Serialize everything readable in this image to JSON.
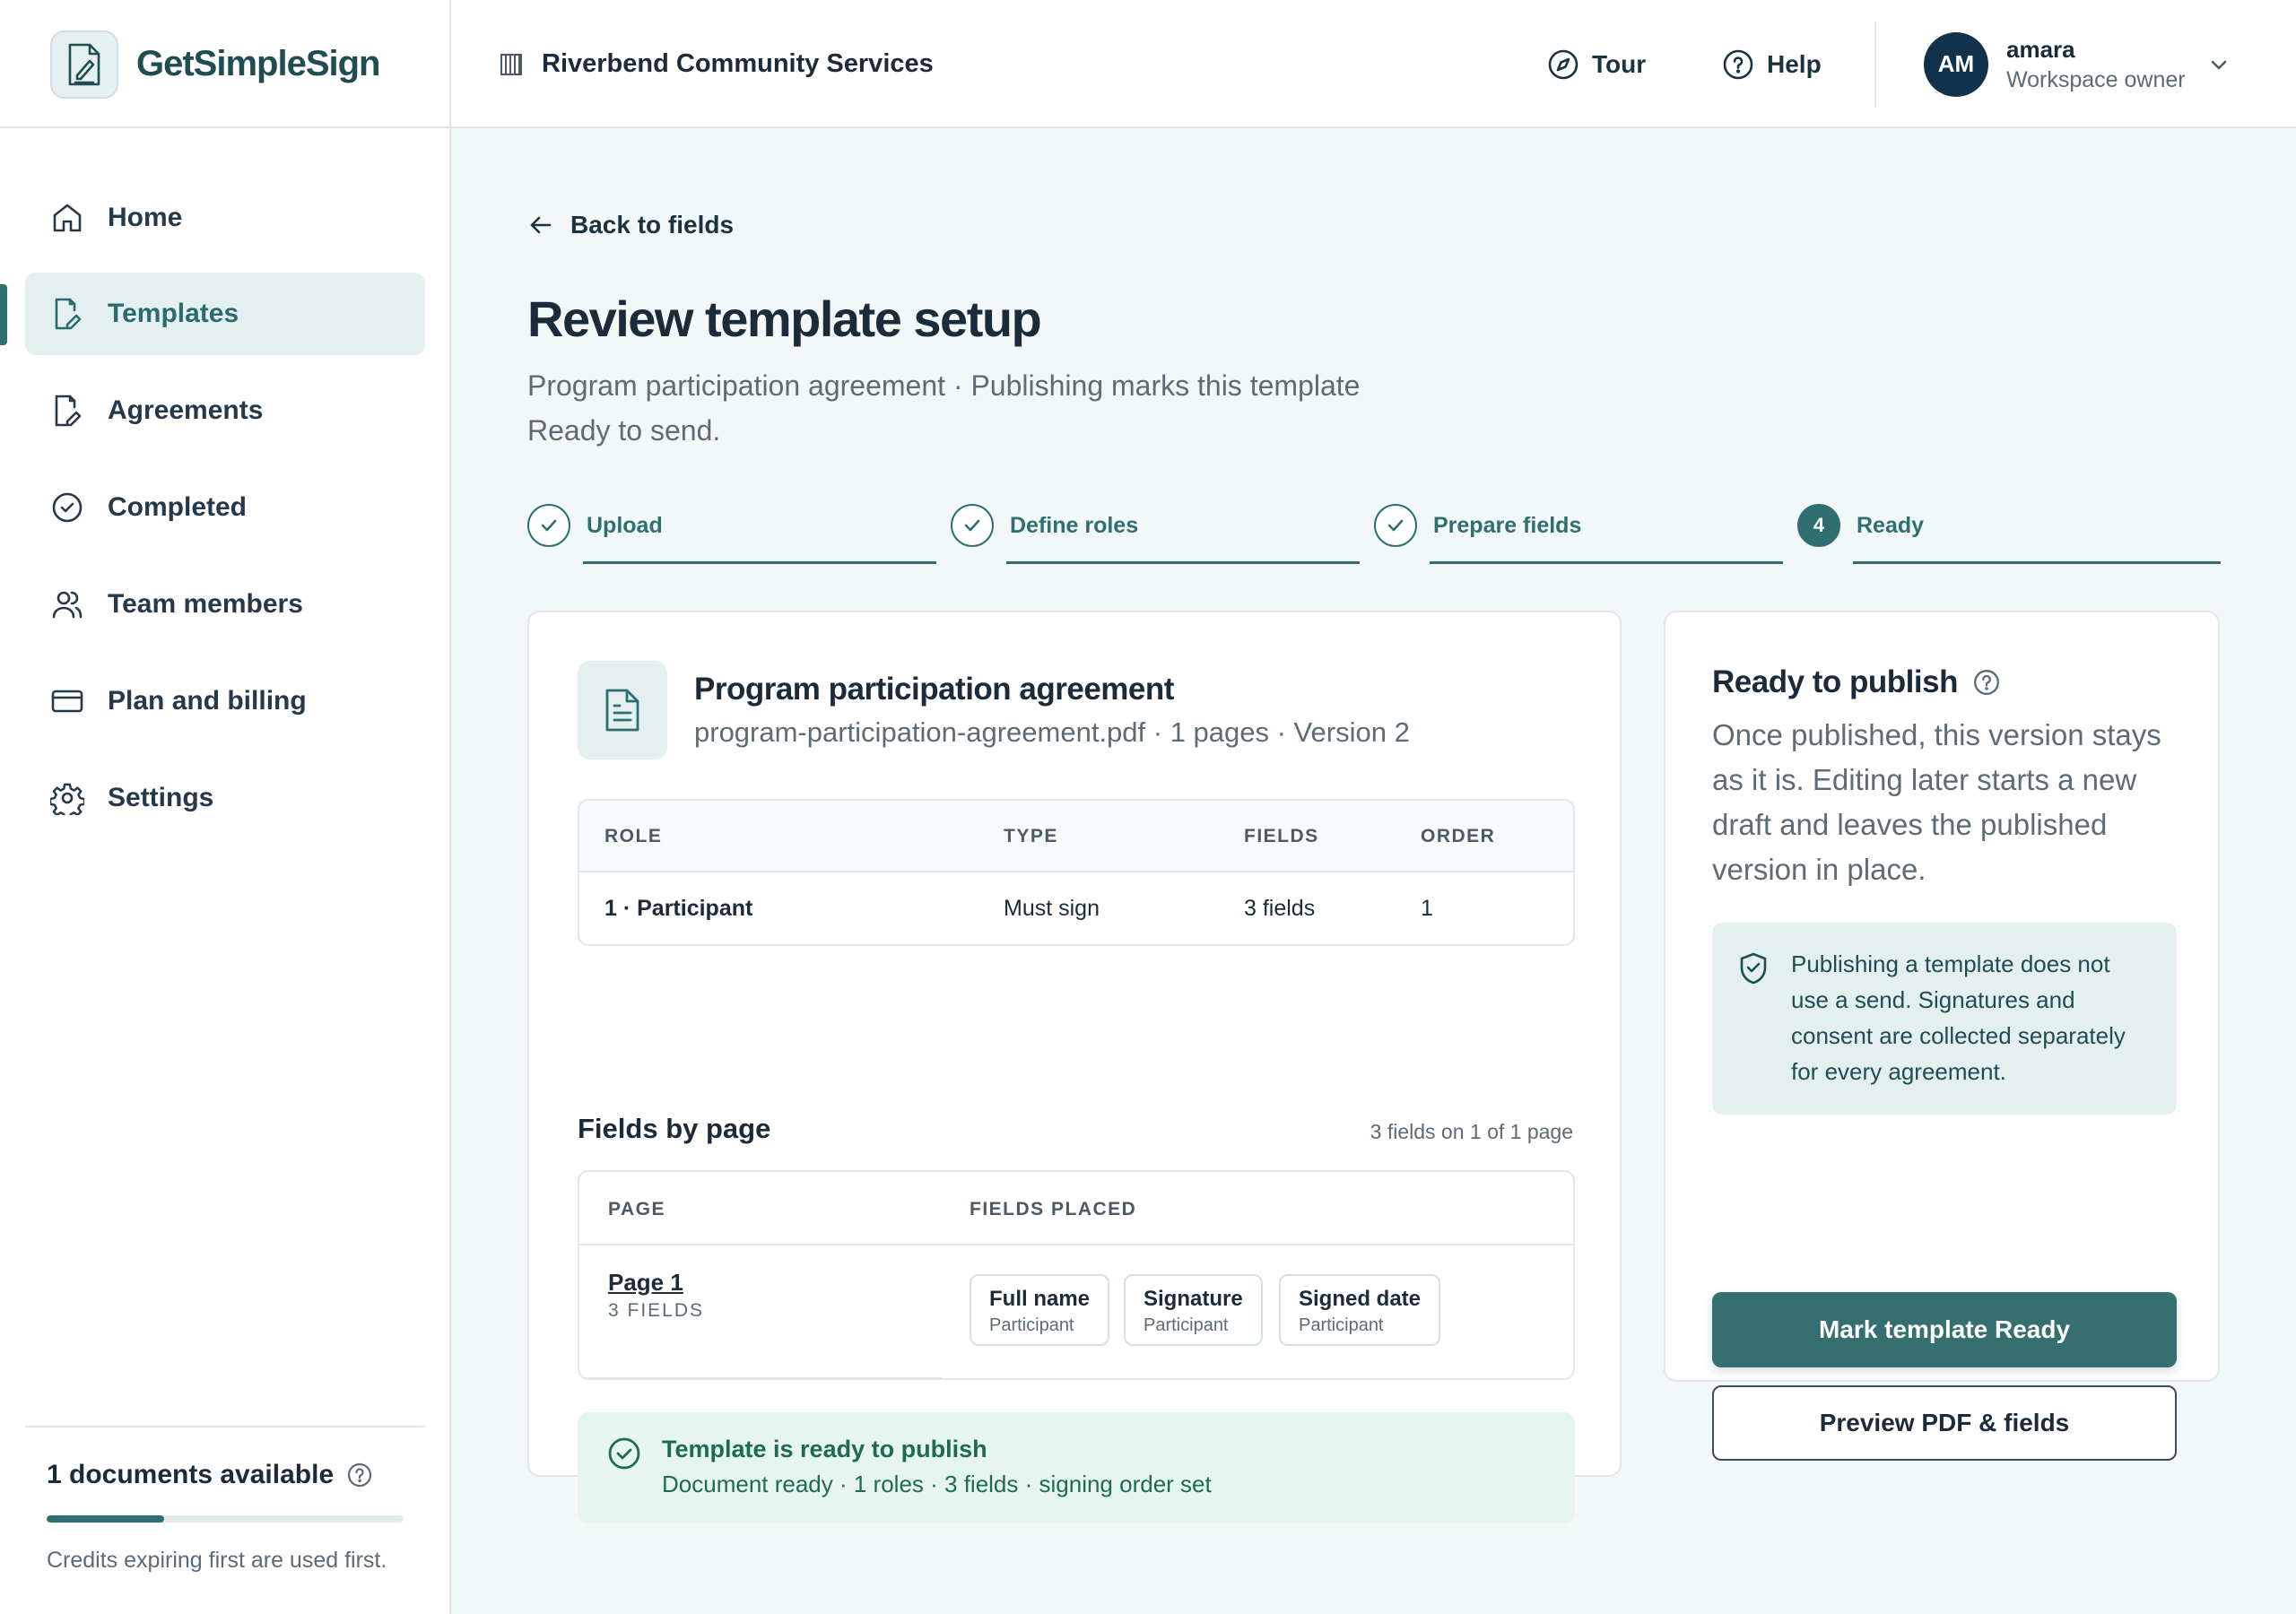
{
  "brand": {
    "name": "GetSimpleSign",
    "logo_icon": "pen-document-icon"
  },
  "org": {
    "name": "Riverbend Community Services"
  },
  "top": {
    "tour": "Tour",
    "help": "Help"
  },
  "user": {
    "initials": "AM",
    "name": "amara",
    "role": "Workspace owner"
  },
  "sidebar": {
    "items": [
      {
        "label": "Home",
        "icon": "home-icon"
      },
      {
        "label": "Templates",
        "icon": "template-icon",
        "active": true
      },
      {
        "label": "Agreements",
        "icon": "agreement-icon"
      },
      {
        "label": "Completed",
        "icon": "check-circle-icon"
      },
      {
        "label": "Team members",
        "icon": "users-icon"
      },
      {
        "label": "Plan and billing",
        "icon": "credit-card-icon"
      },
      {
        "label": "Settings",
        "icon": "gear-icon"
      }
    ],
    "credits": {
      "title": "1 documents available",
      "progress_fraction": 0.33,
      "note": "Credits expiring first are used first."
    }
  },
  "main": {
    "back": "Back to fields",
    "title": "Review template setup",
    "subtitle_line1": "Program participation agreement · Publishing marks this template",
    "subtitle_line2": "Ready to send.",
    "steps": [
      {
        "label": "Upload",
        "state": "done"
      },
      {
        "label": "Define roles",
        "state": "done"
      },
      {
        "label": "Prepare fields",
        "state": "done"
      },
      {
        "label": "Ready",
        "state": "current",
        "number": "4"
      }
    ],
    "document": {
      "title": "Program participation agreement",
      "meta": "program-participation-agreement.pdf · 1 pages · Version 2"
    },
    "roles_table": {
      "headers": [
        "ROLE",
        "TYPE",
        "FIELDS",
        "ORDER"
      ],
      "rows": [
        {
          "role": "1 · Participant",
          "type": "Must sign",
          "fields": "3 fields",
          "order": "1"
        }
      ]
    },
    "fields_by_page": {
      "title": "Fields by page",
      "count": "3 fields on 1 of 1 page",
      "headers": [
        "PAGE",
        "FIELDS PLACED"
      ],
      "rows": [
        {
          "page": "Page 1",
          "page_sub": "3 FIELDS",
          "chips": [
            {
              "name": "Full name",
              "role": "Participant"
            },
            {
              "name": "Signature",
              "role": "Participant"
            },
            {
              "name": "Signed date",
              "role": "Participant"
            }
          ]
        }
      ]
    },
    "ready_banner": {
      "title": "Template is ready to publish",
      "sub": "Document ready · 1 roles · 3 fields · signing order set"
    }
  },
  "publish": {
    "title": "Ready to publish",
    "body": "Once published, this version stays as it is. Editing later starts a new draft and leaves the published version in place.",
    "info": "Publishing a template does not use a send. Signatures and consent are collected separately for every agreement.",
    "primary": "Mark template Ready",
    "secondary": "Preview PDF & fields"
  },
  "colors": {
    "accent": "#2f6f72",
    "success": "#1f6b4d",
    "navy": "#12314a"
  }
}
